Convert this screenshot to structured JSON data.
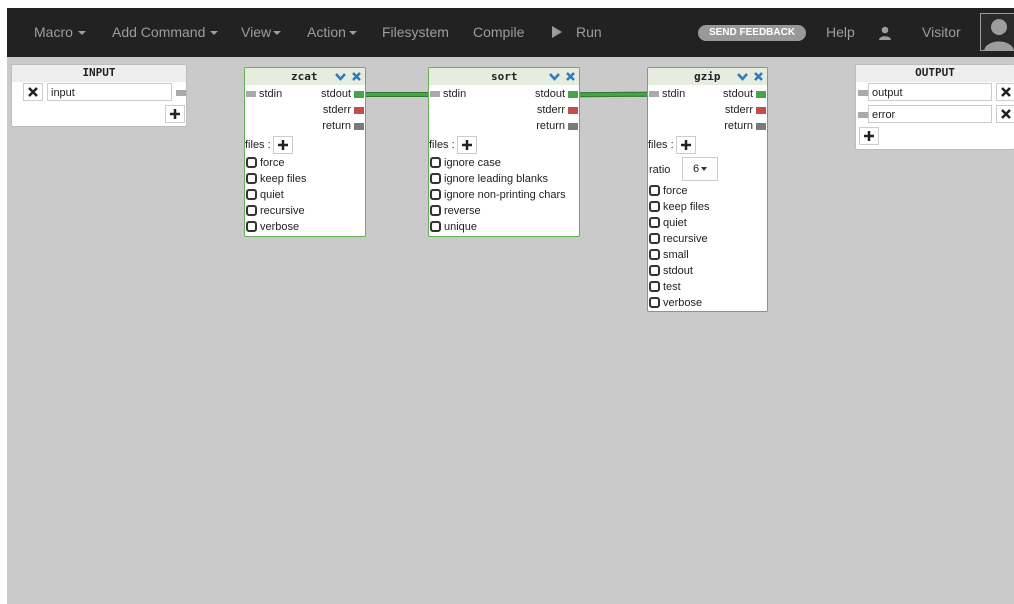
{
  "navbar": {
    "items": [
      {
        "label": "Macro"
      },
      {
        "label": "Add Command"
      },
      {
        "label": "View"
      },
      {
        "label": "Action"
      },
      {
        "label": "Filesystem"
      },
      {
        "label": "Compile"
      },
      {
        "label": "Run"
      }
    ],
    "feedback_label": "SEND FEEDBACK",
    "help_label": "Help",
    "user_label": "Visitor"
  },
  "input_node": {
    "title": "INPUT",
    "fields": [
      {
        "value": "input"
      }
    ]
  },
  "output_node": {
    "title": "OUTPUT",
    "fields": [
      {
        "value": "output"
      },
      {
        "value": "error"
      }
    ]
  },
  "ports": {
    "stdin": "stdin",
    "stdout": "stdout",
    "stderr": "stderr",
    "return": "return",
    "files": "files :"
  },
  "zcat": {
    "title": "zcat",
    "options": [
      "force",
      "keep files",
      "quiet",
      "recursive",
      "verbose"
    ]
  },
  "sort": {
    "title": "sort",
    "options": [
      "ignore case",
      "ignore leading blanks",
      "ignore non-printing chars",
      "reverse",
      "unique"
    ]
  },
  "gzip": {
    "title": "gzip",
    "ratio_label": "ratio",
    "ratio_value": "6",
    "options": [
      "force",
      "keep files",
      "quiet",
      "recursive",
      "small",
      "stdout",
      "test",
      "verbose"
    ]
  },
  "colors": {
    "navbar": "#222222",
    "canvas": "#cacaca",
    "node_border": "#67b05a",
    "wire": "#4aa24a",
    "stderr": "#c84a4a",
    "accent_icon": "#2a7ac8"
  }
}
